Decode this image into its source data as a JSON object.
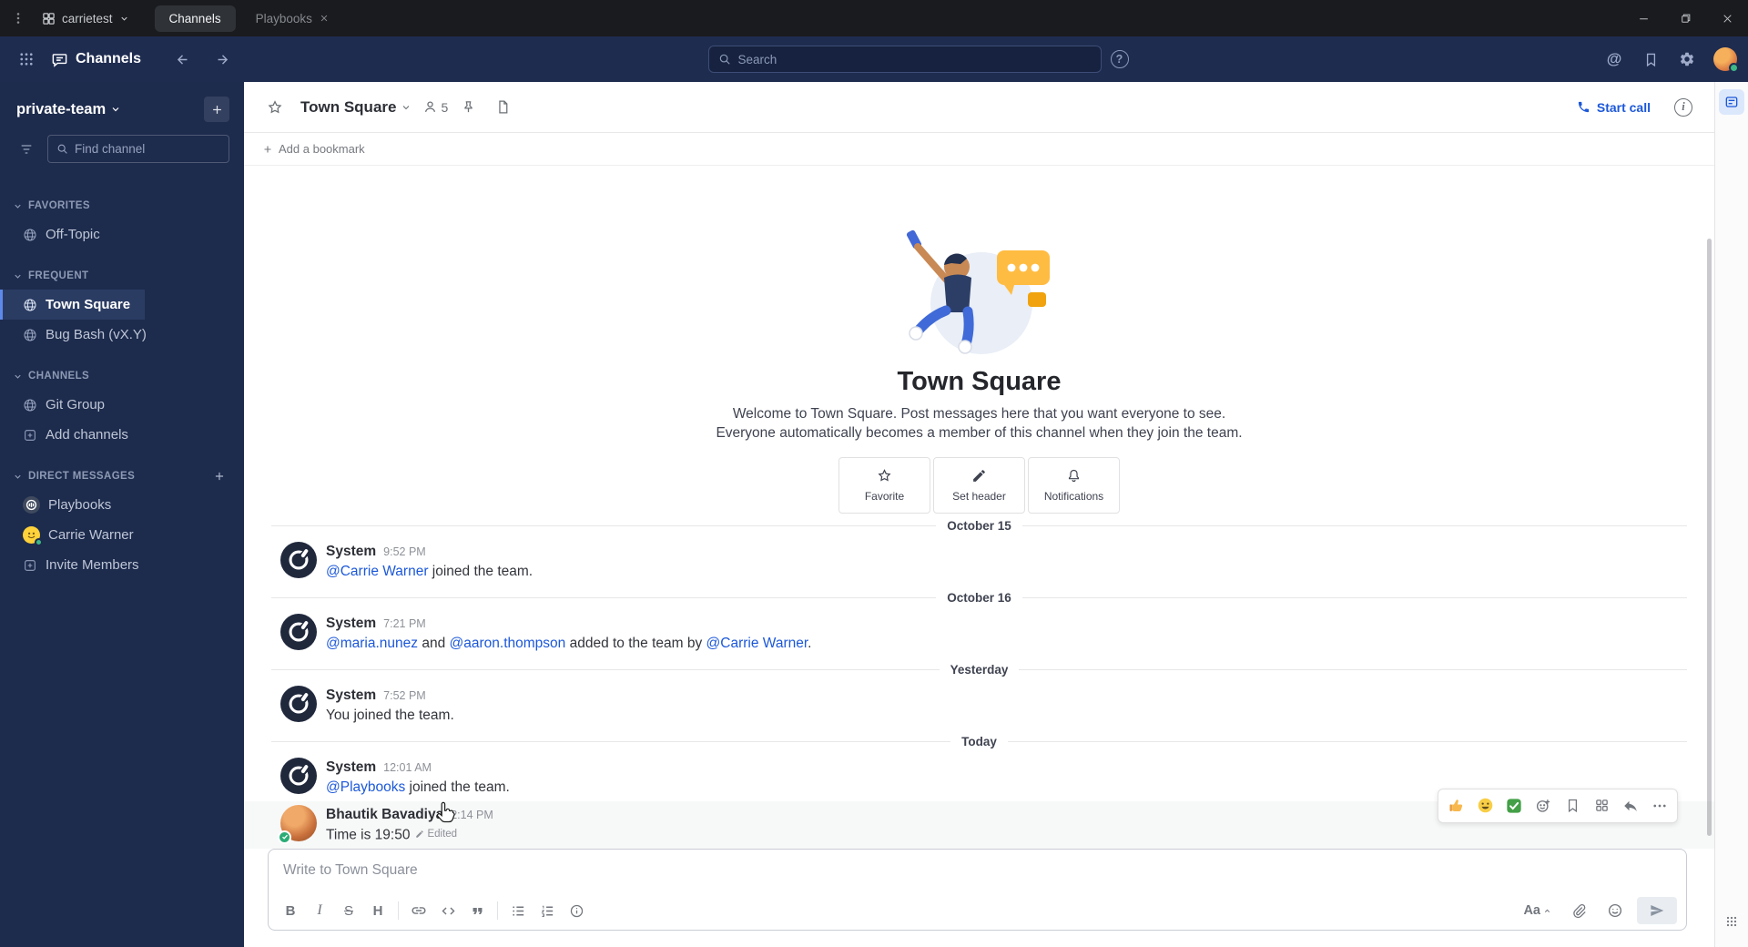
{
  "colors": {
    "accent": "#1c58d9",
    "header_bg": "#1e2c50",
    "sidebar_bg": "#1d2b4d",
    "titlebar_bg": "#1a1b1e",
    "link": "#1c58d9",
    "online_green": "#3db887"
  },
  "titlebar": {
    "team": "carrietest",
    "tab_channels": "Channels",
    "tab_playbooks": "Playbooks",
    "window_controls": [
      "minimize",
      "maximize",
      "close"
    ]
  },
  "global_header": {
    "product_name": "Channels",
    "search_placeholder": "Search",
    "at_glyph": "@",
    "help_glyph": "?"
  },
  "sidebar": {
    "team_name": "private-team",
    "find_placeholder": "Find channel",
    "sections": [
      {
        "label": "FAVORITES",
        "items": [
          {
            "label": "Off-Topic"
          }
        ]
      },
      {
        "label": "FREQUENT",
        "items": [
          {
            "label": "Town Square"
          },
          {
            "label": "Bug Bash (vX.Y)"
          }
        ]
      },
      {
        "label": "CHANNELS",
        "items": [
          {
            "label": "Git Group"
          },
          {
            "label": "Add channels"
          }
        ]
      },
      {
        "label": "DIRECT MESSAGES",
        "items": [
          {
            "label": "Playbooks"
          },
          {
            "label": "Carrie Warner"
          },
          {
            "label": "Invite Members"
          }
        ]
      }
    ]
  },
  "channel_header": {
    "name": "Town Square",
    "member_count": "5",
    "start_call_label": "Start call",
    "info_glyph": "i"
  },
  "bookmark_bar": {
    "add_label": "Add a bookmark"
  },
  "intro": {
    "title": "Town Square",
    "description": "Welcome to Town Square. Post messages here that you want everyone to see. Everyone automatically becomes a member of this channel when they join the team.",
    "action_favorite": "Favorite",
    "action_set_header": "Set header",
    "action_notifications": "Notifications"
  },
  "timeline": {
    "divider1": "October 15",
    "msg1": {
      "sender": "System",
      "time": "9:52 PM",
      "link1": "@Carrie Warner",
      "text1": " joined the team."
    },
    "divider2": "October 16",
    "msg2": {
      "sender": "System",
      "time": "7:21 PM",
      "link1": "@maria.nunez",
      "text1": " and ",
      "link2": "@aaron.thompson",
      "text2": " added to the team by ",
      "link3": "@Carrie Warner",
      "text3": "."
    },
    "divider3": "Yesterday",
    "msg3": {
      "sender": "System",
      "time": "7:52 PM",
      "text1": "You joined the team."
    },
    "divider4": "Today",
    "msg4": {
      "sender": "System",
      "time": "12:01 AM",
      "link1": "@Playbooks",
      "text1": " joined the team."
    },
    "msg5": {
      "sender": "Bhautik Bavadiya",
      "time": "2:14 PM",
      "text1": "Time is 19:50",
      "edited_label": "Edited"
    }
  },
  "hover_toolbar": {
    "icons": [
      "thumbs-up-reaction",
      "smile-reaction",
      "check-reaction",
      "add-reaction",
      "save-message",
      "message-actions",
      "reply",
      "more"
    ]
  },
  "composer": {
    "placeholder": "Write to Town Square",
    "bold": "B",
    "italic": "I",
    "strike": "S",
    "heading": "H",
    "formatting_label": "Aa"
  }
}
